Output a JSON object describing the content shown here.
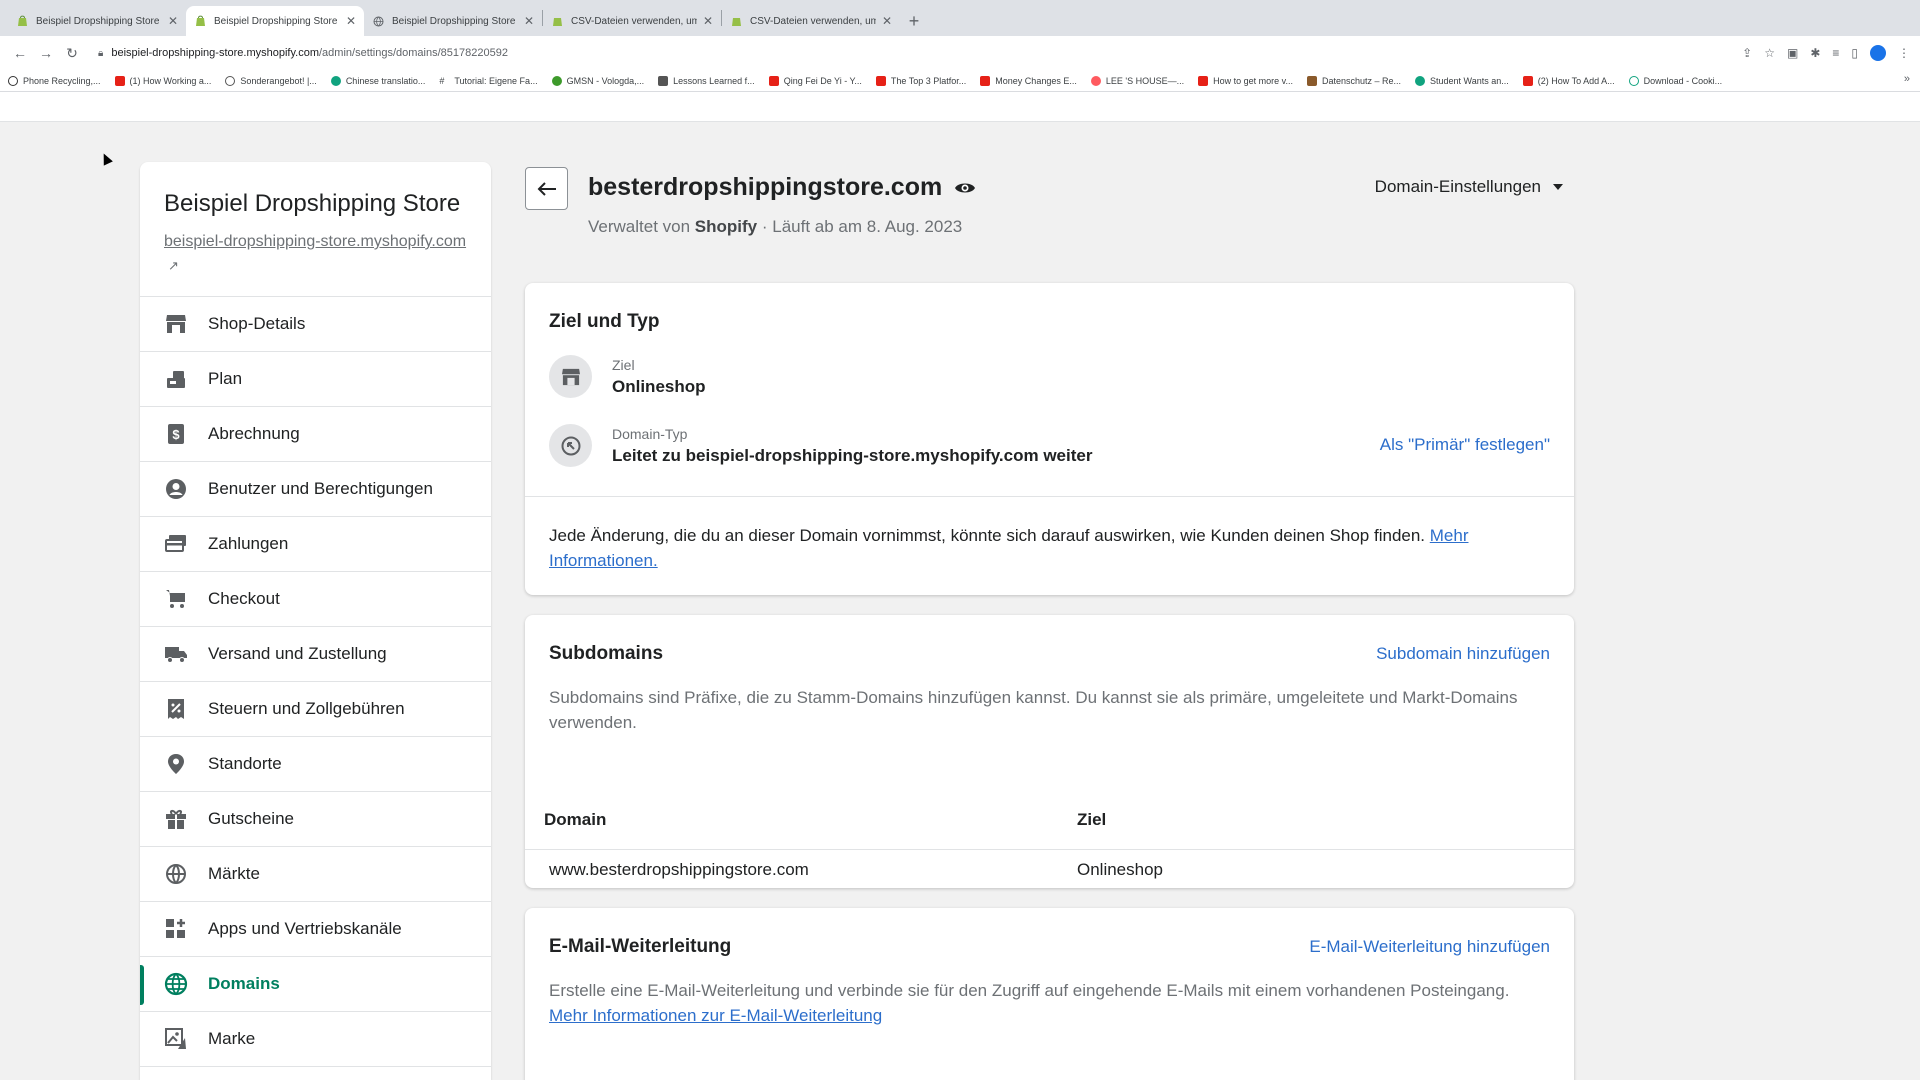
{
  "browser": {
    "tabs": [
      {
        "title": "Beispiel Dropshipping Store · D",
        "active": false
      },
      {
        "title": "Beispiel Dropshipping Store · D",
        "active": true
      },
      {
        "title": "Beispiel Dropshipping Store",
        "active": false
      },
      {
        "title": "CSV-Dateien verwenden, um P",
        "active": false
      },
      {
        "title": "CSV-Dateien verwenden, um P",
        "active": false
      }
    ],
    "url_host": "beispiel-dropshipping-store.myshopify.com",
    "url_path": "/admin/settings/domains/85178220592",
    "bookmarks": [
      "Phone Recycling,...",
      "(1) How Working a...",
      "Sonderangebot! |...",
      "Chinese translatio...",
      "Tutorial: Eigene Fa...",
      "GMSN - Vologda,...",
      "Lessons Learned f...",
      "Qing Fei De Yi - Y...",
      "The Top 3 Platfor...",
      "Money Changes E...",
      "LEE 'S HOUSE—...",
      "How to get more v...",
      "Datenschutz – Re...",
      "Student Wants an...",
      "(2) How To Add A...",
      "Download - Cooki..."
    ]
  },
  "sidebar": {
    "store_name": "Beispiel Dropshipping Store",
    "store_url": "beispiel-dropshipping-store.myshopify.com",
    "items": [
      {
        "label": "Shop-Details",
        "icon": "store-icon"
      },
      {
        "label": "Plan",
        "icon": "plan-icon"
      },
      {
        "label": "Abrechnung",
        "icon": "billing-icon"
      },
      {
        "label": "Benutzer und Berechtigungen",
        "icon": "user-icon"
      },
      {
        "label": "Zahlungen",
        "icon": "payments-icon"
      },
      {
        "label": "Checkout",
        "icon": "cart-icon"
      },
      {
        "label": "Versand und Zustellung",
        "icon": "truck-icon"
      },
      {
        "label": "Steuern und Zollgebühren",
        "icon": "tax-icon"
      },
      {
        "label": "Standorte",
        "icon": "location-icon"
      },
      {
        "label": "Gutscheine",
        "icon": "gift-icon"
      },
      {
        "label": "Märkte",
        "icon": "globe-icon"
      },
      {
        "label": "Apps und Vertriebskanäle",
        "icon": "apps-icon"
      },
      {
        "label": "Domains",
        "icon": "domains-icon",
        "active": true
      },
      {
        "label": "Marke",
        "icon": "brand-icon"
      }
    ]
  },
  "header": {
    "title": "besterdropshippingstore.com",
    "sub_prefix": "Verwaltet von",
    "sub_owner": "Shopify",
    "sub_suffix": "· Läuft ab am 8. Aug. 2023",
    "settings_label": "Domain-Einstellungen"
  },
  "target_card": {
    "title": "Ziel und Typ",
    "target_label": "Ziel",
    "target_value": "Onlineshop",
    "type_label": "Domain-Typ",
    "type_value": "Leitet zu beispiel-dropshipping-store.myshopify.com weiter",
    "primary_link": "Als \"Primär\" festlegen\"",
    "notice": "Jede Änderung, die du an dieser Domain vornimmst, könnte sich darauf auswirken, wie Kunden deinen Shop finden.",
    "notice_link": "Mehr Informationen."
  },
  "subdomains_card": {
    "title": "Subdomains",
    "add_link": "Subdomain hinzufügen",
    "description": "Subdomains sind Präfixe, die zu Stamm-Domains hinzufügen kannst. Du kannst sie als primäre, umgeleitete und Markt-Domains verwenden.",
    "col_domain": "Domain",
    "col_target": "Ziel",
    "rows": [
      {
        "domain": "www.besterdropshippingstore.com",
        "target": "Onlineshop"
      }
    ]
  },
  "email_card": {
    "title": "E-Mail-Weiterleitung",
    "add_link": "E-Mail-Weiterleitung hinzufügen",
    "description": "Erstelle eine E-Mail-Weiterleitung und verbinde sie für den Zugriff auf eingehende E-Mails mit einem vorhandenen Posteingang.",
    "link": "Mehr Informationen zur E-Mail-Weiterleitung"
  },
  "colors": {
    "accent": "#007f5f",
    "link": "#2c6ecb"
  }
}
